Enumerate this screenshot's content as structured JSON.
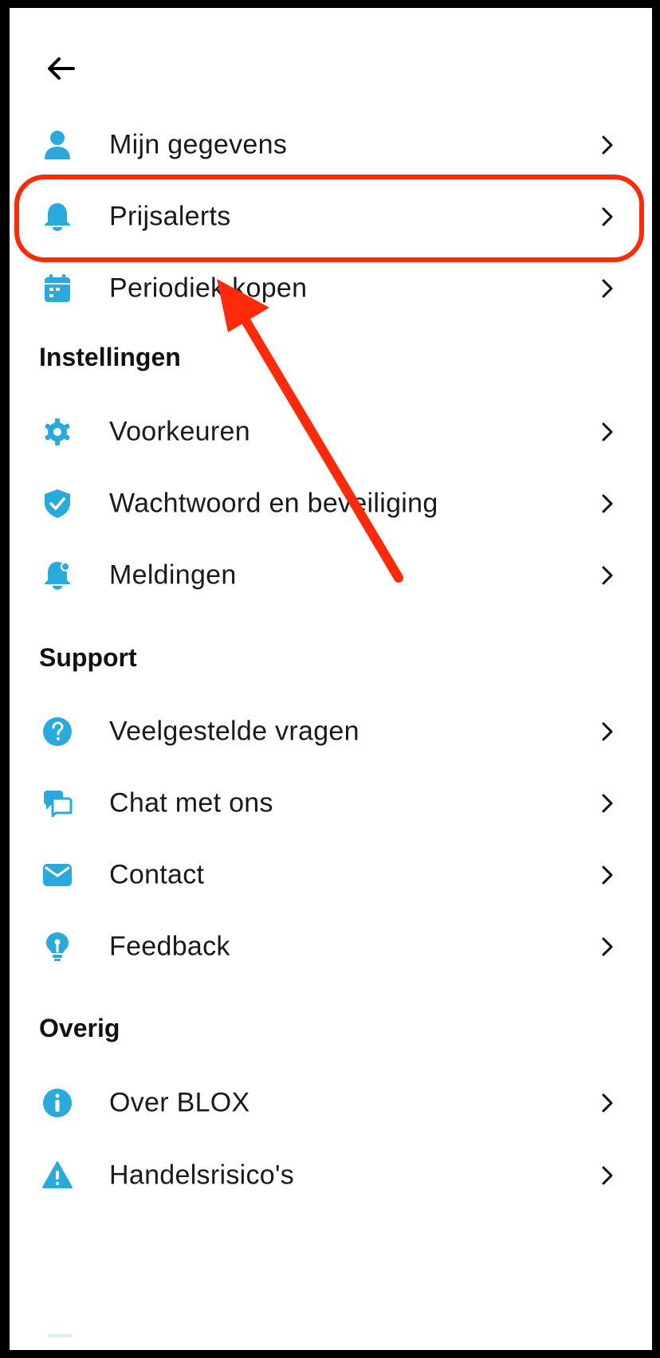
{
  "header": {
    "back_icon": "arrow-left-icon"
  },
  "account": {
    "items": [
      {
        "label": "Mijn gegevens",
        "icon": "user-icon"
      },
      {
        "label": "Prijsalerts",
        "icon": "bell-icon"
      },
      {
        "label": "Periodiek kopen",
        "icon": "calendar-icon"
      }
    ]
  },
  "settings": {
    "title": "Instellingen",
    "items": [
      {
        "label": "Voorkeuren",
        "icon": "gear-icon"
      },
      {
        "label": "Wachtwoord en beveiliging",
        "icon": "shield-check-icon"
      },
      {
        "label": "Meldingen",
        "icon": "notification-bell-icon"
      }
    ]
  },
  "support": {
    "title": "Support",
    "items": [
      {
        "label": "Veelgestelde vragen",
        "icon": "question-icon"
      },
      {
        "label": "Chat met ons",
        "icon": "chat-icon"
      },
      {
        "label": "Contact",
        "icon": "envelope-icon"
      },
      {
        "label": "Feedback",
        "icon": "lightbulb-icon"
      }
    ]
  },
  "other": {
    "title": "Overig",
    "items": [
      {
        "label": "Over BLOX",
        "icon": "info-icon"
      },
      {
        "label": "Handelsrisico's",
        "icon": "warning-icon"
      }
    ]
  },
  "colors": {
    "icon_accent": "#29A9DC",
    "highlight": "#FF2A0A",
    "text": "#1A1A1A"
  }
}
